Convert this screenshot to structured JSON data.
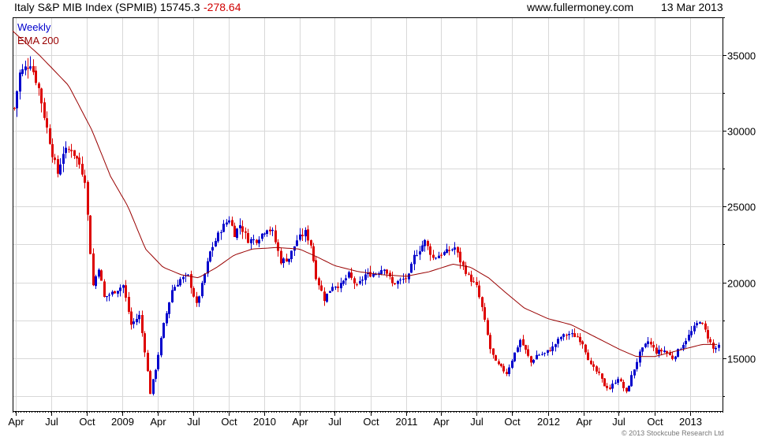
{
  "header": {
    "title": "Italy S&P MIB Index (SPMIB) 15745.3",
    "change": "-278.64",
    "site": "www.fullermoney.com",
    "date": "13 Mar 2013"
  },
  "footer": {
    "credit": "© 2013 Stockcube Research Ltd"
  },
  "colors": {
    "up": "#0000cc",
    "down": "#dd0000",
    "ema": "#990000",
    "grid": "#d8d8d8",
    "axis": "#000000",
    "credit": "#777777"
  },
  "chart_data": {
    "type": "candlestick",
    "frequency": "weekly",
    "legend": [
      "Weekly",
      "EMA 200"
    ],
    "x_tick_labels": [
      "Apr",
      "Jul",
      "Oct",
      "2009",
      "Apr",
      "Jul",
      "Oct",
      "2010",
      "Apr",
      "Jul",
      "Oct",
      "2011",
      "Apr",
      "Jul",
      "Oct",
      "2012",
      "Apr",
      "Jul",
      "Oct",
      "2013"
    ],
    "x_ticks_dates": [
      "2008-04-01",
      "2008-07-01",
      "2008-10-01",
      "2009-01-01",
      "2009-04-01",
      "2009-07-01",
      "2009-10-01",
      "2010-01-01",
      "2010-04-01",
      "2010-07-01",
      "2010-10-01",
      "2011-01-01",
      "2011-04-01",
      "2011-07-01",
      "2011-10-01",
      "2012-01-01",
      "2012-04-01",
      "2012-07-01",
      "2012-10-01",
      "2013-01-01"
    ],
    "xlim": [
      "2008-03-24",
      "2013-03-25"
    ],
    "y_tick_values": [
      15000,
      20000,
      25000,
      30000,
      35000
    ],
    "y_tick_labels": [
      "15000",
      "20000",
      "25000",
      "30000",
      "35000"
    ],
    "ylim": [
      11500,
      37500
    ],
    "grid": true,
    "y_axis_side": "right",
    "legend_placement": "top-left",
    "close_path": [
      [
        "2008-03-24",
        31500
      ],
      [
        "2008-04-07",
        33800
      ],
      [
        "2008-05-05",
        34500
      ],
      [
        "2008-05-26",
        32800
      ],
      [
        "2008-06-09",
        31000
      ],
      [
        "2008-06-30",
        28500
      ],
      [
        "2008-07-14",
        27200
      ],
      [
        "2008-07-28",
        28600
      ],
      [
        "2008-08-18",
        28800
      ],
      [
        "2008-09-08",
        27800
      ],
      [
        "2008-09-22",
        26800
      ],
      [
        "2008-10-06",
        22000
      ],
      [
        "2008-10-13",
        19800
      ],
      [
        "2008-10-27",
        21000
      ],
      [
        "2008-11-10",
        19000
      ],
      [
        "2008-12-01",
        19300
      ],
      [
        "2008-12-29",
        19800
      ],
      [
        "2009-01-19",
        17200
      ],
      [
        "2009-02-09",
        17800
      ],
      [
        "2009-02-23",
        15500
      ],
      [
        "2009-03-09",
        12700
      ],
      [
        "2009-03-23",
        14300
      ],
      [
        "2009-04-13",
        17200
      ],
      [
        "2009-05-04",
        19500
      ],
      [
        "2009-05-25",
        20200
      ],
      [
        "2009-06-15",
        20400
      ],
      [
        "2009-07-06",
        18500
      ],
      [
        "2009-07-20",
        19800
      ],
      [
        "2009-08-10",
        22000
      ],
      [
        "2009-09-07",
        23500
      ],
      [
        "2009-09-28",
        24200
      ],
      [
        "2009-10-12",
        23200
      ],
      [
        "2009-10-26",
        23800
      ],
      [
        "2009-11-16",
        22800
      ],
      [
        "2009-12-07",
        22800
      ],
      [
        "2010-01-04",
        23600
      ],
      [
        "2010-01-18",
        23300
      ],
      [
        "2010-02-08",
        21400
      ],
      [
        "2010-03-01",
        21600
      ],
      [
        "2010-03-22",
        22800
      ],
      [
        "2010-04-12",
        23300
      ],
      [
        "2010-04-26",
        22500
      ],
      [
        "2010-05-10",
        20400
      ],
      [
        "2010-05-31",
        18900
      ],
      [
        "2010-06-21",
        19800
      ],
      [
        "2010-07-12",
        19800
      ],
      [
        "2010-08-02",
        20500
      ],
      [
        "2010-08-23",
        19700
      ],
      [
        "2010-09-13",
        20500
      ],
      [
        "2010-10-11",
        20600
      ],
      [
        "2010-11-01",
        21000
      ],
      [
        "2010-11-22",
        19900
      ],
      [
        "2010-12-13",
        20100
      ],
      [
        "2011-01-03",
        20400
      ],
      [
        "2011-01-17",
        21700
      ],
      [
        "2011-02-14",
        22700
      ],
      [
        "2011-03-07",
        21600
      ],
      [
        "2011-03-21",
        21800
      ],
      [
        "2011-04-11",
        22000
      ],
      [
        "2011-05-02",
        22300
      ],
      [
        "2011-05-16",
        21400
      ],
      [
        "2011-06-06",
        20400
      ],
      [
        "2011-06-27",
        19700
      ],
      [
        "2011-07-11",
        18300
      ],
      [
        "2011-08-01",
        15600
      ],
      [
        "2011-08-15",
        14700
      ],
      [
        "2011-09-12",
        14000
      ],
      [
        "2011-09-26",
        14900
      ],
      [
        "2011-10-17",
        16200
      ],
      [
        "2011-10-31",
        15500
      ],
      [
        "2011-11-14",
        14700
      ],
      [
        "2011-11-28",
        15200
      ],
      [
        "2011-12-19",
        15300
      ],
      [
        "2012-01-09",
        15700
      ],
      [
        "2012-01-30",
        16400
      ],
      [
        "2012-02-20",
        16600
      ],
      [
        "2012-03-12",
        16400
      ],
      [
        "2012-03-26",
        16000
      ],
      [
        "2012-04-16",
        14500
      ],
      [
        "2012-05-07",
        13900
      ],
      [
        "2012-05-21",
        13200
      ],
      [
        "2012-06-04",
        13000
      ],
      [
        "2012-06-25",
        13700
      ],
      [
        "2012-07-16",
        12700
      ],
      [
        "2012-07-30",
        13800
      ],
      [
        "2012-08-20",
        15300
      ],
      [
        "2012-09-10",
        16100
      ],
      [
        "2012-10-01",
        15400
      ],
      [
        "2012-10-22",
        15500
      ],
      [
        "2012-11-12",
        15000
      ],
      [
        "2012-12-03",
        15700
      ],
      [
        "2013-01-07",
        17000
      ],
      [
        "2013-01-21",
        17500
      ],
      [
        "2013-02-04",
        16800
      ],
      [
        "2013-02-25",
        15600
      ],
      [
        "2013-03-11",
        15745
      ]
    ],
    "ema_200_path": [
      [
        "2008-03-24",
        36600
      ],
      [
        "2008-06-01",
        35000
      ],
      [
        "2008-08-15",
        33000
      ],
      [
        "2008-10-15",
        30000
      ],
      [
        "2008-12-01",
        27000
      ],
      [
        "2009-01-15",
        25000
      ],
      [
        "2009-03-01",
        22200
      ],
      [
        "2009-04-15",
        21000
      ],
      [
        "2009-06-01",
        20500
      ],
      [
        "2009-07-15",
        20300
      ],
      [
        "2009-09-01",
        21000
      ],
      [
        "2009-10-15",
        21800
      ],
      [
        "2009-12-01",
        22200
      ],
      [
        "2010-02-01",
        22300
      ],
      [
        "2010-04-01",
        22200
      ],
      [
        "2010-05-15",
        21700
      ],
      [
        "2010-07-01",
        21100
      ],
      [
        "2010-09-01",
        20700
      ],
      [
        "2010-11-01",
        20500
      ],
      [
        "2011-01-01",
        20400
      ],
      [
        "2011-03-01",
        20700
      ],
      [
        "2011-05-01",
        21200
      ],
      [
        "2011-06-15",
        21000
      ],
      [
        "2011-08-01",
        20300
      ],
      [
        "2011-09-15",
        19300
      ],
      [
        "2011-11-01",
        18300
      ],
      [
        "2012-01-01",
        17600
      ],
      [
        "2012-03-01",
        17200
      ],
      [
        "2012-05-01",
        16400
      ],
      [
        "2012-07-01",
        15600
      ],
      [
        "2012-08-15",
        15100
      ],
      [
        "2012-10-01",
        15100
      ],
      [
        "2012-12-01",
        15500
      ],
      [
        "2013-02-01",
        15900
      ],
      [
        "2013-03-11",
        15900
      ]
    ]
  }
}
